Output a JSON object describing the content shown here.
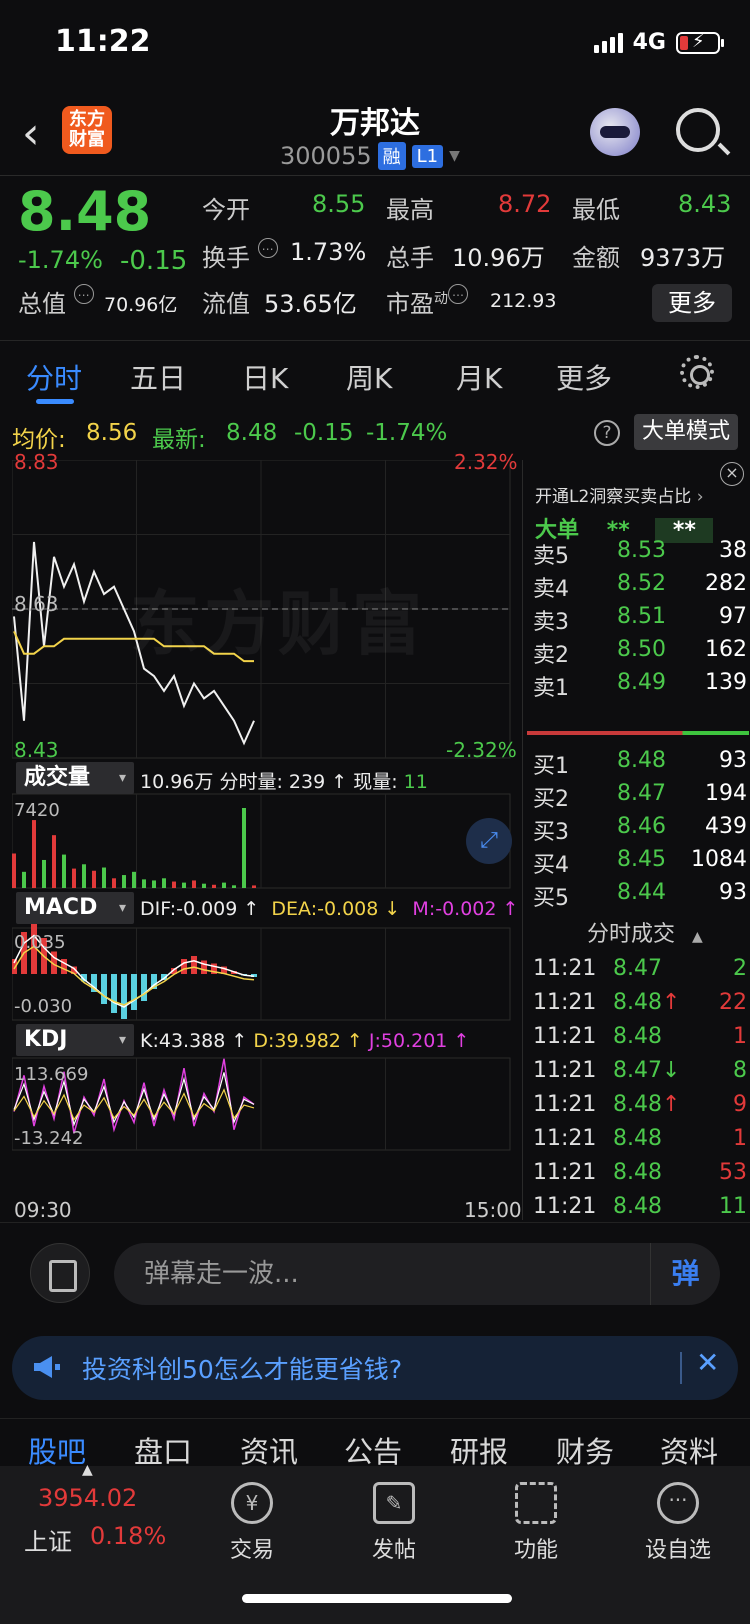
{
  "status": {
    "time": "11:22",
    "network": "4G"
  },
  "header": {
    "logo": "东方财富",
    "name": "万邦达",
    "code": "300055",
    "tag_margin": "融",
    "tag_level": "L1"
  },
  "quote": {
    "price": "8.48",
    "change_pct": "-1.74%",
    "change": "-0.15",
    "open_label": "今开",
    "open": "8.55",
    "high_label": "最高",
    "high": "8.72",
    "low_label": "最低",
    "low": "8.43",
    "turnover_label": "换手",
    "turnover": "1.73%",
    "volume_label": "总手",
    "volume": "10.96万",
    "amount_label": "金额",
    "amount": "9373万",
    "mktcap_label": "总值",
    "mktcap": "70.96亿",
    "float_label": "流值",
    "float": "53.65亿",
    "pe_label": "市盈",
    "pe_sup": "动",
    "pe": "212.93",
    "more": "更多"
  },
  "tabs": [
    "分时",
    "五日",
    "日K",
    "周K",
    "月K",
    "更多"
  ],
  "inforow": {
    "avg_label": "均价:",
    "avg": "8.56",
    "last_label": "最新:",
    "last": "8.48",
    "chg": "-0.15",
    "pct": "-1.74%",
    "help": "?",
    "bigorder_btn": "大单模式"
  },
  "chart": {
    "ymax": "8.83",
    "ymid": "8.63",
    "ymin": "8.43",
    "pmax": "2.32%",
    "pmin": "-2.32%",
    "watermark": "东方财富",
    "vol_btn": "成交量",
    "vol_total": "10.96万",
    "vol_min_label": "分时量:",
    "vol_min": "239",
    "vol_now_label": "现量:",
    "vol_now": "11",
    "vol_axis": "7420",
    "macd_btn": "MACD",
    "dif": "DIF:-0.009",
    "dea": "DEA:-0.008",
    "m": "M:-0.002",
    "macd_top": "0.035",
    "macd_bot": "-0.030",
    "kdj_btn": "KDJ",
    "k": "K:43.388",
    "d": "D:39.982",
    "j": "J:50.201",
    "kdj_top": "113.669",
    "kdj_bot": "-13.242",
    "t_start": "09:30",
    "t_end": "15:00"
  },
  "chart_data": {
    "type": "line",
    "title": "",
    "x_range": [
      "09:30",
      "15:00"
    ],
    "ylim": [
      8.43,
      8.83
    ],
    "prev_close": 8.63,
    "series": [
      {
        "name": "",
        "values": [
          8.62,
          8.48,
          8.72,
          8.58,
          8.7,
          8.66,
          8.69,
          8.64,
          8.68,
          8.65,
          8.66,
          8.63,
          8.6,
          8.55,
          8.54,
          8.52,
          8.54,
          8.5,
          8.53,
          8.51,
          8.52,
          8.5,
          8.48,
          8.45,
          8.48
        ]
      },
      {
        "name": "均价",
        "values": [
          8.6,
          8.57,
          8.57,
          8.58,
          8.58,
          8.59,
          8.59,
          8.59,
          8.59,
          8.59,
          8.59,
          8.59,
          8.59,
          8.59,
          8.59,
          8.58,
          8.58,
          8.58,
          8.58,
          8.58,
          8.57,
          8.57,
          8.57,
          8.56,
          8.56
        ]
      }
    ],
    "volume": [
      3200,
      1500,
      6300,
      2600,
      4900,
      3100,
      1800,
      2200,
      1600,
      1900,
      900,
      1200,
      1500,
      800,
      700,
      900,
      600,
      500,
      700,
      400,
      300,
      500,
      250,
      7420,
      239
    ],
    "macd": [
      0.01,
      0.028,
      0.035,
      0.024,
      0.015,
      0.01,
      0.005,
      -0.005,
      -0.012,
      -0.02,
      -0.026,
      -0.03,
      -0.024,
      -0.018,
      -0.01,
      -0.004,
      0.004,
      0.01,
      0.012,
      0.009,
      0.007,
      0.005,
      0.002,
      -0.001,
      -0.002
    ],
    "kdj_j": [
      40,
      90,
      20,
      75,
      30,
      95,
      10,
      60,
      35,
      85,
      15,
      55,
      25,
      80,
      20,
      70,
      30,
      100,
      20,
      65,
      40,
      113,
      15,
      60,
      50
    ]
  },
  "book": {
    "l2": "开通L2洞察买卖占比",
    "bigorder": "大单",
    "stars1": "**",
    "stars2": "**",
    "asks": [
      {
        "label": "卖5",
        "price": "8.53",
        "vol": "38"
      },
      {
        "label": "卖4",
        "price": "8.52",
        "vol": "282"
      },
      {
        "label": "卖3",
        "price": "8.51",
        "vol": "97"
      },
      {
        "label": "卖2",
        "price": "8.50",
        "vol": "162"
      },
      {
        "label": "卖1",
        "price": "8.49",
        "vol": "139"
      }
    ],
    "bids": [
      {
        "label": "买1",
        "price": "8.48",
        "vol": "93"
      },
      {
        "label": "买2",
        "price": "8.47",
        "vol": "194"
      },
      {
        "label": "买3",
        "price": "8.46",
        "vol": "439"
      },
      {
        "label": "买4",
        "price": "8.45",
        "vol": "1084"
      },
      {
        "label": "买5",
        "price": "8.44",
        "vol": "93"
      }
    ],
    "trade_header": "分时成交",
    "trades": [
      {
        "time": "11:21",
        "price": "8.47",
        "dir": "",
        "vol": "2",
        "color": "green"
      },
      {
        "time": "11:21",
        "price": "8.48",
        "dir": "↑",
        "vol": "22",
        "color": "red"
      },
      {
        "time": "11:21",
        "price": "8.48",
        "dir": "",
        "vol": "1",
        "color": "red"
      },
      {
        "time": "11:21",
        "price": "8.47",
        "dir": "↓",
        "vol": "8",
        "color": "green"
      },
      {
        "time": "11:21",
        "price": "8.48",
        "dir": "↑",
        "vol": "9",
        "color": "red"
      },
      {
        "time": "11:21",
        "price": "8.48",
        "dir": "",
        "vol": "1",
        "color": "red"
      },
      {
        "time": "11:21",
        "price": "8.48",
        "dir": "",
        "vol": "53",
        "color": "red"
      },
      {
        "time": "11:21",
        "price": "8.48",
        "dir": "",
        "vol": "11",
        "color": "green"
      }
    ]
  },
  "danmu": {
    "placeholder": "弹幕走一波...",
    "send": "弹"
  },
  "banner": {
    "text": "投资科创50怎么才能更省钱?"
  },
  "subtabs": [
    "股吧",
    "盘口",
    "资讯",
    "公告",
    "研报",
    "财务",
    "资料"
  ],
  "bottom": {
    "index_value": "3954.02",
    "index_name": "上证",
    "index_pct": "0.18%",
    "nav": [
      "交易",
      "发帖",
      "功能",
      "设自选"
    ]
  },
  "colors": {
    "up": "#e23a3a",
    "down": "#4cc94c",
    "accent": "#3a8bff"
  }
}
